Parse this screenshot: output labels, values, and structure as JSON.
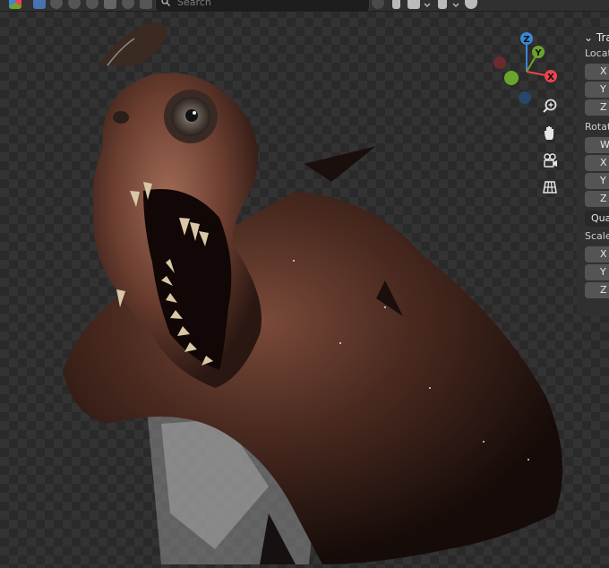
{
  "header": {
    "search": {
      "placeholder": "Search",
      "icon": "search-icon"
    },
    "icons": [
      "blender-logo-icon",
      "object-mode-icon",
      "shading-icon",
      "constraint-icon",
      "render-icon",
      "scene-icon",
      "world-icon",
      "sculpt-icon",
      "modifier-icon",
      "view-icon",
      "bookmark-icon",
      "layout-icon",
      "chevron-down-icon",
      "pin-icon",
      "chevron-down-icon",
      "shield-icon"
    ]
  },
  "gizmo": {
    "x": "X",
    "y": "Y",
    "z": "Z",
    "colors": {
      "x": "#e8454f",
      "y": "#6ba42c",
      "z": "#3a87d8"
    }
  },
  "nav_buttons": [
    "zoom-icon",
    "hand-pan-icon",
    "camera-icon",
    "grid-icon"
  ],
  "npanel": {
    "title": "Tra",
    "location": {
      "label": "Locat",
      "fields": [
        "X",
        "Y",
        "Z"
      ]
    },
    "rotation": {
      "label": "Rotat",
      "fields": [
        "W",
        "X",
        "Y",
        "Z"
      ],
      "mode": "Qua"
    },
    "scale": {
      "label": "Scale",
      "fields": [
        "X",
        "Y",
        "Z"
      ]
    }
  }
}
